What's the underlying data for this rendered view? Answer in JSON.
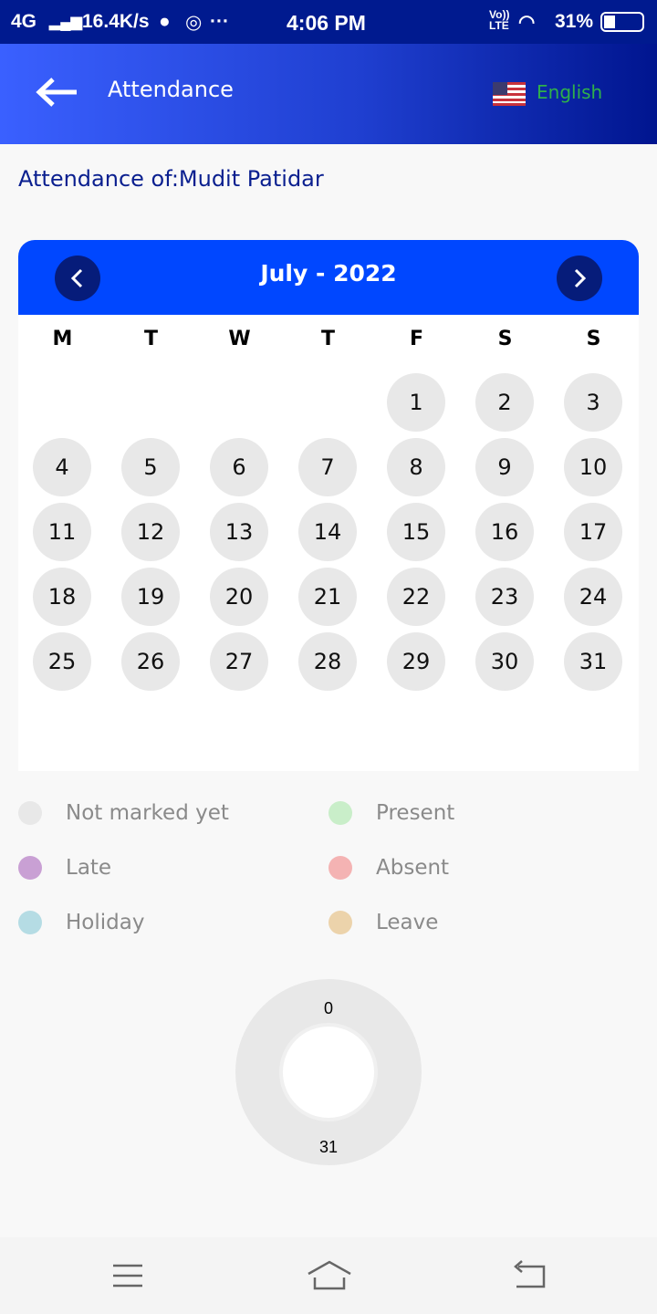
{
  "status_bar": {
    "network": "4G",
    "speed": "16.4K/s",
    "time": "4:06 PM",
    "lte": "Vo)) LTE",
    "battery": "31%"
  },
  "app_bar": {
    "title": "Attendance",
    "language": "English",
    "flag_icon": "us-flag-icon"
  },
  "subtitle": "Attendance of:Mudit Patidar",
  "calendar": {
    "month_label": "July - 2022",
    "weekdays": [
      "M",
      "T",
      "W",
      "T",
      "F",
      "S",
      "S"
    ],
    "weeks": [
      [
        null,
        null,
        null,
        null,
        1,
        2,
        3
      ],
      [
        4,
        5,
        6,
        7,
        8,
        9,
        10
      ],
      [
        11,
        12,
        13,
        14,
        15,
        16,
        17
      ],
      [
        18,
        19,
        20,
        21,
        22,
        23,
        24
      ],
      [
        25,
        26,
        27,
        28,
        29,
        30,
        31
      ]
    ],
    "day_color": "#e8e8e8",
    "header_color": "#0047ff"
  },
  "legend": [
    {
      "label": "Not marked yet",
      "color": "#e8e8e8"
    },
    {
      "label": "Present",
      "color": "#c9eec9"
    },
    {
      "label": "Late",
      "color": "#c9a0d4"
    },
    {
      "label": "Absent",
      "color": "#f4b3b3"
    },
    {
      "label": "Holiday",
      "color": "#b5dce4"
    },
    {
      "label": "Leave",
      "color": "#ecd3ab"
    }
  ],
  "chart_data": {
    "type": "pie",
    "style": "donut",
    "values": [
      {
        "label": "Not marked yet",
        "value": 31,
        "color": "#e8e8e8"
      },
      {
        "label": "Present",
        "value": 0,
        "color": "#c9eec9"
      }
    ],
    "labels": [
      "0",
      "31"
    ]
  }
}
